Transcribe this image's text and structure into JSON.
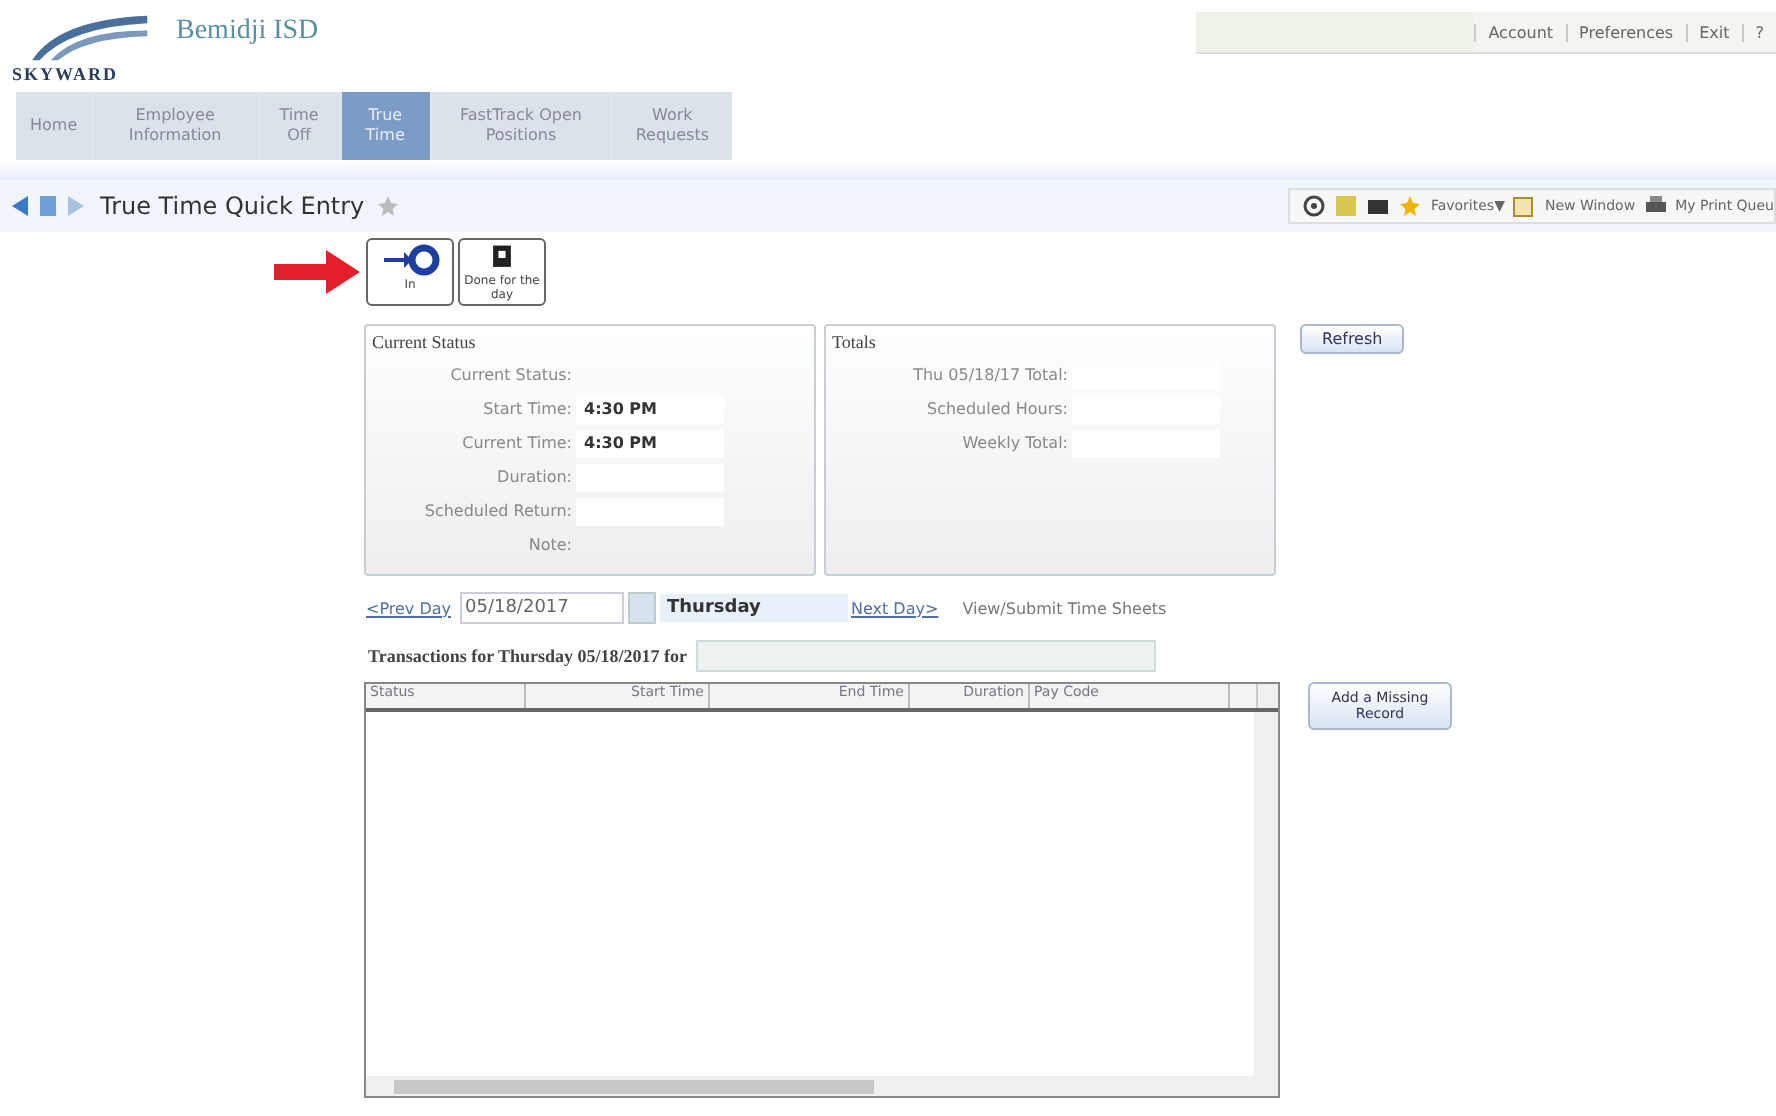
{
  "header": {
    "logo": "SKYWARD",
    "district": "Bemidji ISD",
    "links": [
      "Account",
      "Preferences",
      "Exit",
      "?"
    ]
  },
  "tabs": [
    {
      "label": "Home",
      "selected": false
    },
    {
      "label": "Employee Information",
      "selected": false
    },
    {
      "label": "Time Off",
      "selected": false
    },
    {
      "label": "True Time",
      "selected": true
    },
    {
      "label": "FastTrack Open Positions",
      "selected": false
    },
    {
      "label": "Work Requests",
      "selected": false
    }
  ],
  "page_title": "True Time Quick Entry",
  "toolbar": {
    "favorites": "Favorites▼",
    "new_window": "New Window",
    "print_queue": "My Print Queu"
  },
  "actions": [
    {
      "kind": "in",
      "label": "In"
    },
    {
      "kind": "done",
      "label": "Done for the day"
    }
  ],
  "current_status": {
    "title": "Current Status",
    "fields": [
      {
        "label": "Current Status:",
        "kind": "plain"
      },
      {
        "label": "Start Time:",
        "value": "4:30 PM",
        "kind": "box"
      },
      {
        "label": "Current Time:",
        "value": "4:30 PM",
        "kind": "box"
      },
      {
        "label": "Duration:",
        "kind": "box"
      },
      {
        "label": "Scheduled Return:",
        "kind": "box"
      },
      {
        "label": "Note:",
        "kind": "plain"
      }
    ]
  },
  "totals": {
    "title": "Totals",
    "fields": [
      {
        "label": "Thu 05/18/17 Total:"
      },
      {
        "label": "Scheduled Hours:"
      },
      {
        "label": "Weekly Total:"
      }
    ]
  },
  "refresh": "Refresh",
  "date_nav": {
    "prev": "<Prev Day",
    "date": "05/18/2017",
    "weekday": "Thursday",
    "next": "Next Day>",
    "view": "View/Submit Time Sheets"
  },
  "transactions": {
    "title": "Transactions for Thursday 05/18/2017 for",
    "columns": [
      "Status",
      "Start Time",
      "End Time",
      "Duration",
      "Pay Code"
    ]
  },
  "add_missing": "Add a Missing Record"
}
